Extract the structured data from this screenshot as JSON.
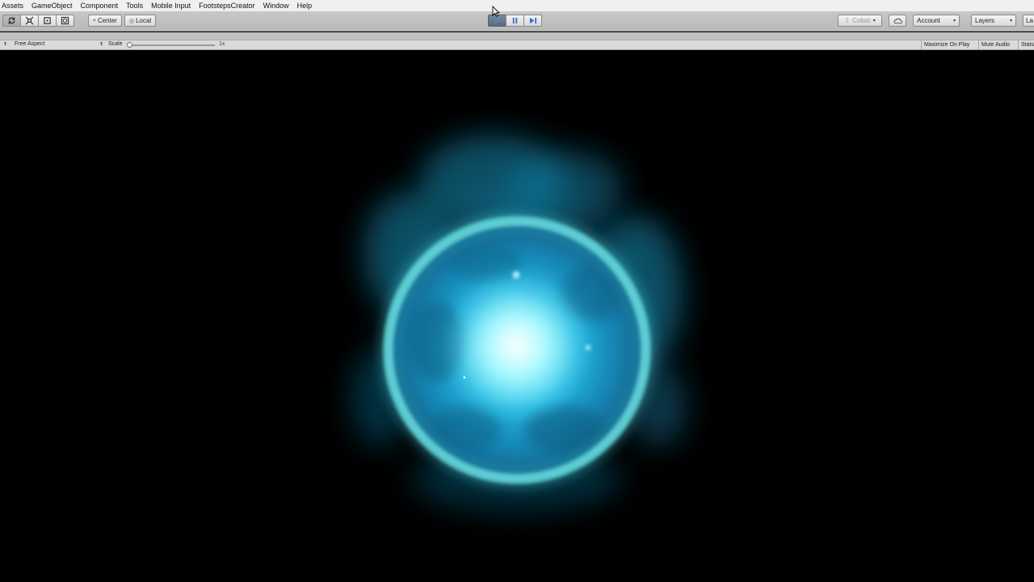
{
  "menu": {
    "items": [
      "Assets",
      "GameObject",
      "Component",
      "Tools",
      "Mobile Input",
      "FootstepsCreator",
      "Window",
      "Help"
    ]
  },
  "toolbar": {
    "pivot_center": "Center",
    "pivot_local": "Local",
    "collab_label": "Collab",
    "account_label": "Account",
    "layers_label": "Layers",
    "layout_label": "La"
  },
  "game_view": {
    "aspect": "Free Aspect",
    "scale_label": "Scale",
    "scale_value": "1x",
    "maximize_on_play": "Maximize On Play",
    "mute_audio": "Mute Audio",
    "stats": "Stats"
  },
  "scene": {
    "ring_color": "#5fd2d6",
    "glow_color": "#1fa6c7",
    "core_color": "#c8fbff",
    "background": "#000000"
  }
}
